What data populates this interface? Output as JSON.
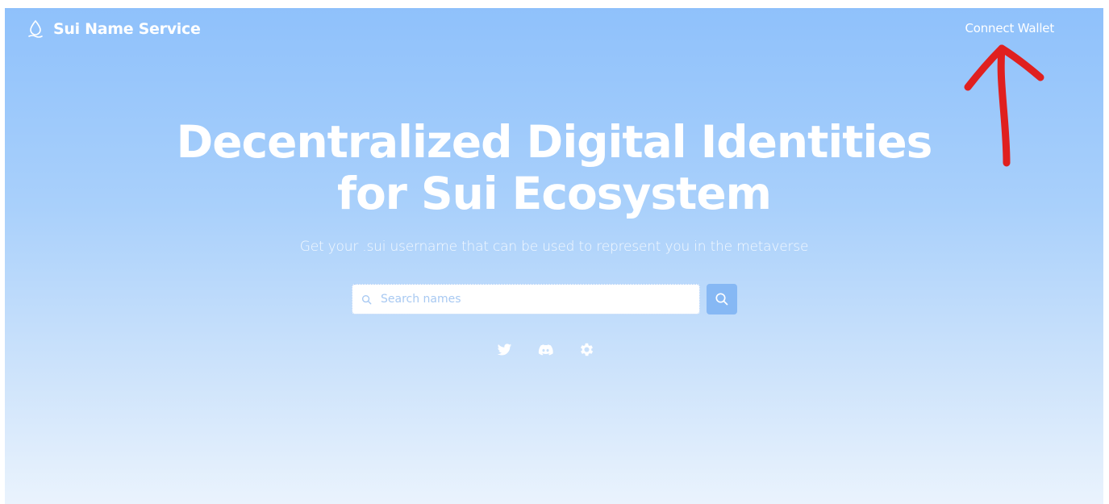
{
  "header": {
    "brand_name": "Sui Name Service",
    "brand_icon": "droplet-icon",
    "connect_wallet_label": "Connect Wallet"
  },
  "hero": {
    "headline_line1": "Decentralized Digital Identities",
    "headline_line2": "for Sui Ecosystem",
    "subtitle": "Get your .sui username that can be used to represent you in the metaverse"
  },
  "search": {
    "placeholder": "Search names",
    "value": "",
    "button_icon": "search-icon"
  },
  "socials": [
    {
      "name": "twitter-icon"
    },
    {
      "name": "discord-icon"
    },
    {
      "name": "gear-icon"
    }
  ],
  "annotation": {
    "shape": "arrow-up",
    "color": "#e0201f"
  },
  "colors": {
    "background_top": "#8fc1fb",
    "background_bottom": "#eaf3fd",
    "search_button": "#86b8f4",
    "text": "#ffffff"
  }
}
